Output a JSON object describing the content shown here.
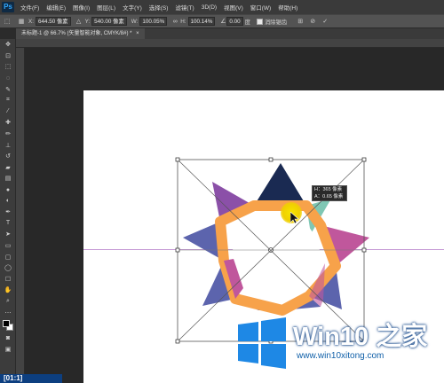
{
  "app": {
    "logo": "Ps"
  },
  "menu": [
    "文件(F)",
    "编辑(E)",
    "图像(I)",
    "图层(L)",
    "文字(Y)",
    "选择(S)",
    "滤镜(T)",
    "3D(D)",
    "视图(V)",
    "窗口(W)",
    "帮助(H)"
  ],
  "options": {
    "x_label": "X:",
    "x_value": "644.50 像素",
    "y_label": "Y:",
    "y_value": "540.00 像素",
    "w_label": "W:",
    "w_value": "100.05%",
    "h_label": "H:",
    "h_value": "100.14%",
    "angle_value": "0.00",
    "angle_unit": "度",
    "interp_label": "消除锯齿"
  },
  "document_tab": {
    "label": "未标题-1 @ 66.7% (矢量智能对象, CMYK/8#) *",
    "close": "×"
  },
  "tooltip": {
    "line1": "H：365 像素",
    "line2": "A：0.65 像素"
  },
  "watermark": {
    "title": "Win10 之家",
    "url": "www.win10xitong.com"
  },
  "corner_badge": "[01:1]",
  "colors": {
    "navy": "#1a2a52",
    "purple": "#8b50a8",
    "blue": "#5c64ad",
    "orange": "#f7a24a",
    "magenta": "#c0579c",
    "teal": "#7fc7b4",
    "guide": "#c79bd6"
  }
}
